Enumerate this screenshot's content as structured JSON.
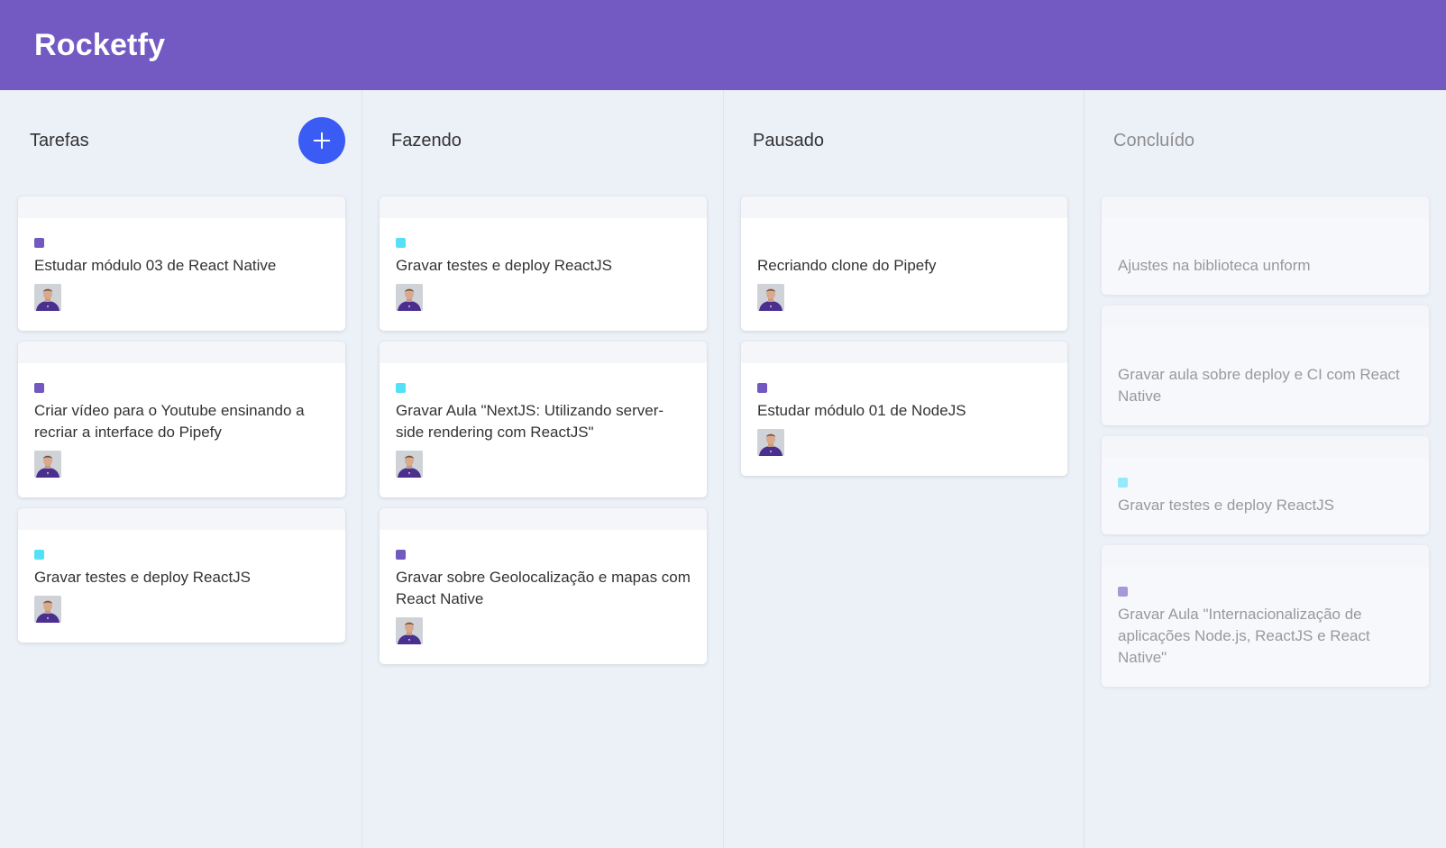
{
  "app": {
    "title": "Rocketfy"
  },
  "colors": {
    "header": "#7359c2",
    "purple_label": "#7159c1",
    "cyan_label": "#54e1f7",
    "add_button": "#3b5bf5"
  },
  "lists": [
    {
      "title": "Tarefas",
      "creatable": true,
      "add_icon": "plus-icon",
      "cards": [
        {
          "content": "Estudar módulo 03 de React Native",
          "label": "#7159c1",
          "user": "avatar"
        },
        {
          "content": "Criar vídeo para o Youtube ensinando a recriar a interface do Pipefy",
          "label": "#7159c1",
          "user": "avatar"
        },
        {
          "content": "Gravar testes e deploy ReactJS",
          "label": "#54e1f7",
          "user": "avatar"
        }
      ]
    },
    {
      "title": "Fazendo",
      "cards": [
        {
          "content": "Gravar testes e deploy ReactJS",
          "label": "#54e1f7",
          "user": "avatar"
        },
        {
          "content": "Gravar Aula \"NextJS: Utilizando server-side rendering com ReactJS\"",
          "label": "#54e1f7",
          "user": "avatar"
        },
        {
          "content": "Gravar sobre Geolocalização e mapas com React Native",
          "label": "#7159c1",
          "user": "avatar"
        }
      ]
    },
    {
      "title": "Pausado",
      "cards": [
        {
          "content": "Recriando clone do Pipefy",
          "label": null,
          "user": "avatar"
        },
        {
          "content": "Estudar módulo 01 de NodeJS",
          "label": "#7159c1",
          "user": "avatar"
        }
      ]
    },
    {
      "title": "Concluído",
      "done": true,
      "cards": [
        {
          "content": "Ajustes na biblioteca unform",
          "label": null
        },
        {
          "content": "Gravar aula sobre deploy e CI com React Native",
          "label": null
        },
        {
          "content": "Gravar testes e deploy ReactJS",
          "label": "#54e1f7"
        },
        {
          "content": "Gravar Aula \"Internacionalização de aplicações Node.js, ReactJS e React Native\"",
          "label": "#7159c1"
        }
      ]
    }
  ]
}
